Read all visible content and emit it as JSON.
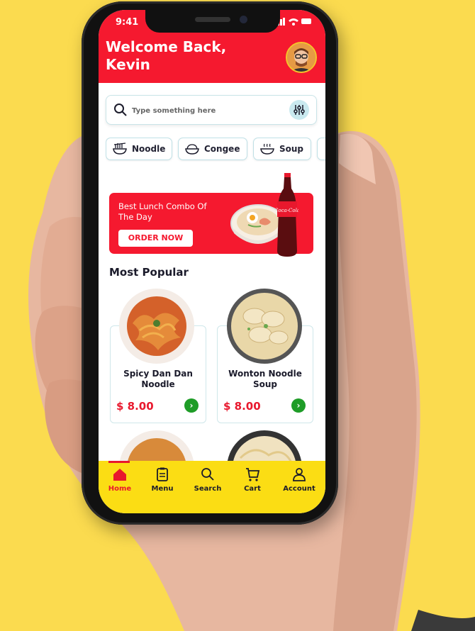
{
  "status": {
    "time": "9:41"
  },
  "header": {
    "welcome": "Welcome Back, Kevin"
  },
  "search": {
    "placeholder": "Type something here"
  },
  "categories": [
    {
      "label": "Noodle",
      "icon": "noodle-icon"
    },
    {
      "label": "Congee",
      "icon": "congee-icon"
    },
    {
      "label": "Soup",
      "icon": "soup-icon"
    }
  ],
  "banner": {
    "title": "Best Lunch Combo Of The Day",
    "cta": "ORDER NOW",
    "bottle_label": "Coca-Cola"
  },
  "popular": {
    "title": "Most Popular",
    "items": [
      {
        "name": "Spicy Dan Dan Noodle",
        "price": "$ 8.00"
      },
      {
        "name": "Wonton Noodle Soup",
        "price": "$ 8.00"
      }
    ]
  },
  "nav": [
    {
      "label": "Home",
      "icon": "home-icon",
      "active": true
    },
    {
      "label": "Menu",
      "icon": "menu-icon",
      "active": false
    },
    {
      "label": "Search",
      "icon": "search-icon",
      "active": false
    },
    {
      "label": "Cart",
      "icon": "cart-icon",
      "active": false
    },
    {
      "label": "Account",
      "icon": "account-icon",
      "active": false
    }
  ],
  "colors": {
    "background": "#fbdb4f",
    "primary_red": "#f5192f",
    "nav_yellow": "#fbdd14",
    "go_green": "#1e9c27"
  }
}
